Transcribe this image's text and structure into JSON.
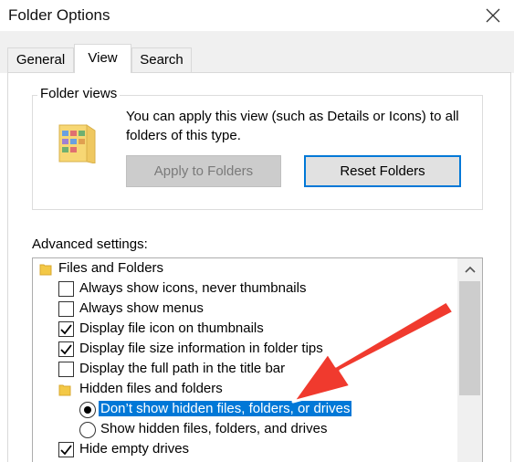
{
  "window": {
    "title": "Folder Options"
  },
  "tabs": [
    {
      "label": "General"
    },
    {
      "label": "View"
    },
    {
      "label": "Search"
    }
  ],
  "folder_views": {
    "label": "Folder views",
    "description": "You can apply this view (such as Details or Icons) to all folders of this type.",
    "apply_button": "Apply to Folders",
    "reset_button": "Reset Folders"
  },
  "advanced": {
    "label": "Advanced settings:",
    "items": [
      {
        "kind": "folder",
        "label": "Files and Folders"
      },
      {
        "kind": "checkbox",
        "label": "Always show icons, never thumbnails",
        "checked": false
      },
      {
        "kind": "checkbox",
        "label": "Always show menus",
        "checked": false
      },
      {
        "kind": "checkbox",
        "label": "Display file icon on thumbnails",
        "checked": true
      },
      {
        "kind": "checkbox",
        "label": "Display file size information in folder tips",
        "checked": true
      },
      {
        "kind": "checkbox",
        "label": "Display the full path in the title bar",
        "checked": false
      },
      {
        "kind": "folder",
        "label": "Hidden files and folders"
      },
      {
        "kind": "radio",
        "label": "Don’t show hidden files, folders, or drives",
        "selected": true
      },
      {
        "kind": "radio",
        "label": "Show hidden files, folders, and drives",
        "selected": false
      },
      {
        "kind": "checkbox",
        "label": "Hide empty drives",
        "checked": true
      }
    ]
  },
  "colors": {
    "accent": "#0078d7",
    "annotation_arrow": "#f03a2e"
  },
  "icons": [
    "close-icon",
    "folder-icon",
    "checkmark-icon",
    "scroll-up-arrow-icon"
  ]
}
